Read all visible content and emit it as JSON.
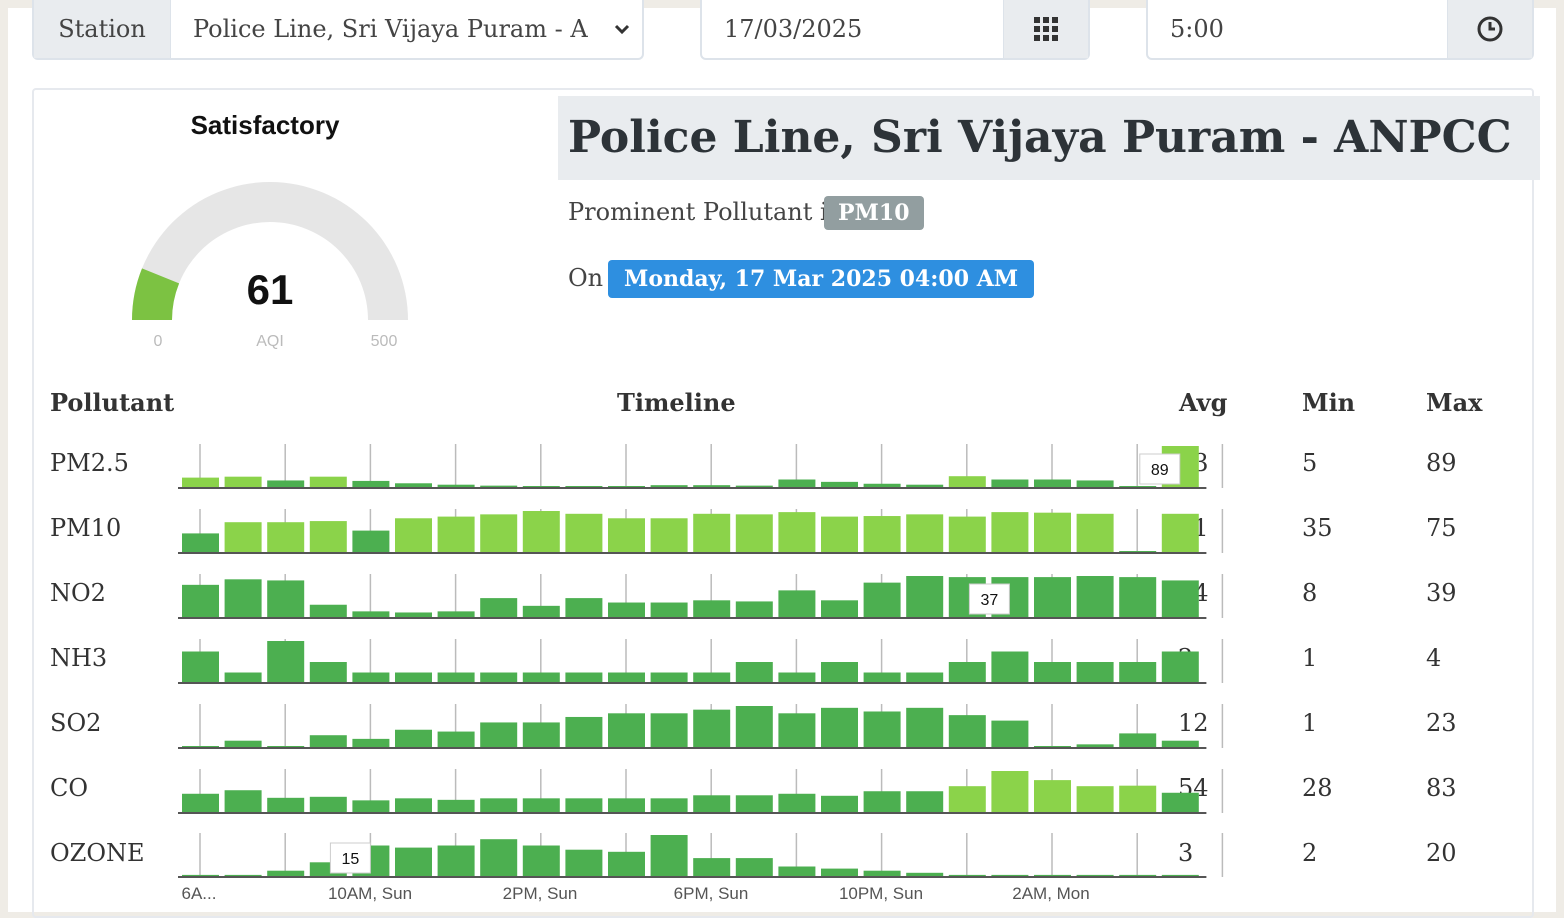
{
  "controls": {
    "station_label": "Station",
    "station_value": "Police Line, Sri Vijaya Puram - A",
    "date_value": "17/03/2025",
    "time_value": "5:00",
    "calendar_icon": "calendar-grid-icon",
    "clock_icon": "clock-icon",
    "dropdown_icon": "chevron-down-icon"
  },
  "aqi": {
    "category": "Satisfactory",
    "value": "61",
    "unit": "AQI",
    "min": "0",
    "max": "500",
    "fraction": 0.122,
    "color": "#7cc242"
  },
  "station": {
    "title": "Police Line, Sri Vijaya Puram - ANPCC",
    "prominent_label": "Prominent Pollutant is",
    "prominent_value": "PM10",
    "on_label": "On",
    "datetime": "Monday, 17 Mar 2025 04:00 AM"
  },
  "table": {
    "headers": {
      "pollutant": "Pollutant",
      "timeline": "Timeline",
      "avg": "Avg",
      "min": "Min",
      "max": "Max"
    },
    "x_labels": [
      "6A...",
      "10AM, Sun",
      "2PM, Sun",
      "6PM, Sun",
      "10PM, Sun",
      "2AM, Mon"
    ],
    "rows": [
      {
        "name": "PM2.5",
        "avg": "33",
        "min": "5",
        "max": "89",
        "tooltip": "89",
        "tooltip_index": 23,
        "values": [
          22,
          24,
          16,
          24,
          15,
          10,
          7,
          5,
          3,
          1,
          1,
          6,
          6,
          5,
          18,
          13,
          9,
          7,
          25,
          18,
          18,
          16,
          1,
          89
        ]
      },
      {
        "name": "PM10",
        "avg": "61",
        "min": "35",
        "max": "75",
        "tooltip": "",
        "tooltip_index": -1,
        "values": [
          35,
          55,
          55,
          57,
          40,
          62,
          65,
          69,
          75,
          70,
          62,
          62,
          70,
          69,
          73,
          65,
          66,
          69,
          65,
          73,
          72,
          70,
          3,
          70
        ]
      },
      {
        "name": "NO2",
        "avg": "24",
        "min": "8",
        "max": "39",
        "tooltip": "37",
        "tooltip_index": 19,
        "values": [
          30,
          35,
          34,
          12,
          6,
          5,
          6,
          18,
          11,
          18,
          14,
          14,
          16,
          15,
          25,
          16,
          32,
          38,
          37,
          37,
          37,
          38,
          37,
          34
        ]
      },
      {
        "name": "NH3",
        "avg": "2",
        "min": "1",
        "max": "4",
        "tooltip": "",
        "tooltip_index": -1,
        "values": [
          3,
          1,
          4,
          2,
          1,
          1,
          1,
          1,
          1,
          1,
          1,
          1,
          1,
          2,
          1,
          2,
          1,
          1,
          2,
          3,
          2,
          2,
          2,
          3
        ]
      },
      {
        "name": "SO2",
        "avg": "12",
        "min": "1",
        "max": "23",
        "tooltip": "",
        "tooltip_index": -1,
        "values": [
          0,
          4,
          0,
          7,
          5,
          10,
          9,
          14,
          14,
          17,
          19,
          19,
          21,
          23,
          19,
          22,
          20,
          22,
          18,
          15,
          1,
          2,
          8,
          4
        ]
      },
      {
        "name": "CO",
        "avg": "54",
        "min": "28",
        "max": "83",
        "tooltip": "",
        "tooltip_index": -1,
        "values": [
          38,
          45,
          30,
          32,
          25,
          29,
          26,
          29,
          29,
          29,
          29,
          29,
          35,
          35,
          38,
          34,
          43,
          43,
          53,
          83,
          65,
          53,
          54,
          40
        ]
      },
      {
        "name": "OZONE",
        "avg": "3",
        "min": "2",
        "max": "20",
        "tooltip": "15",
        "tooltip_index": 4,
        "values": [
          1,
          1,
          3,
          7,
          15,
          14,
          15,
          18,
          15,
          13,
          12,
          20,
          9,
          9,
          5,
          4,
          3,
          2,
          1,
          1,
          1,
          1,
          1,
          1
        ]
      }
    ]
  },
  "colors": {
    "dark_green": "#4caf50",
    "light_green": "#8bd34a",
    "baseline": "#555555",
    "tick": "#bbbbbb"
  }
}
